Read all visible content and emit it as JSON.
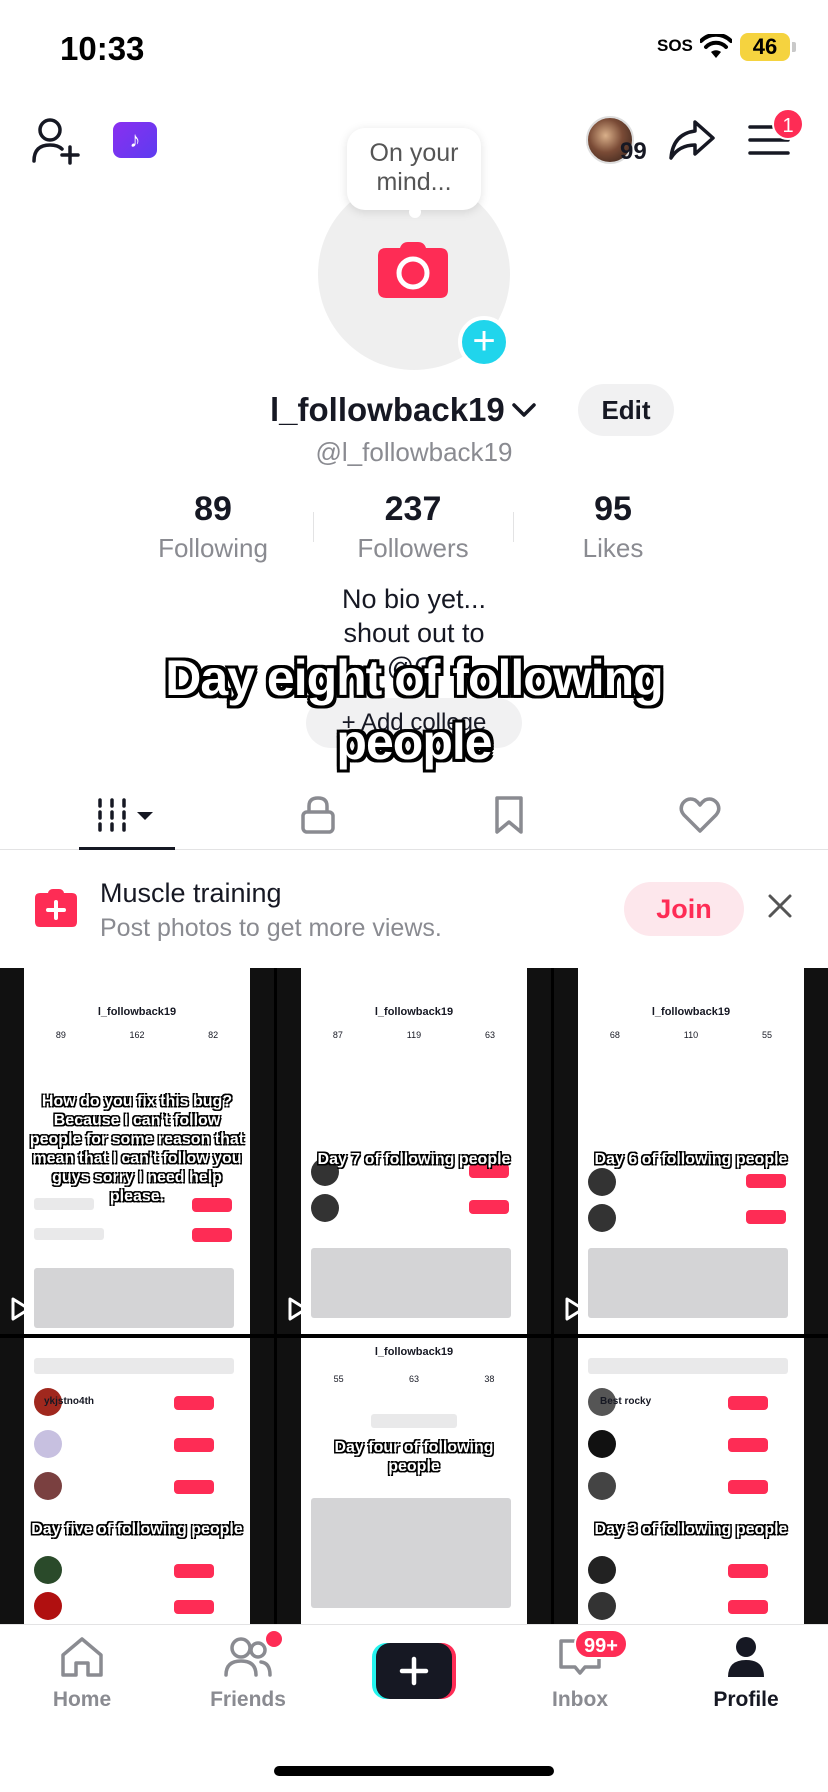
{
  "status_bar": {
    "time": "10:33",
    "sos": "SOS",
    "battery": "46"
  },
  "top_bar": {
    "story_count": "99",
    "menu_badge": "1"
  },
  "profile": {
    "mind_prompt": "On your mind...",
    "username": "l_followback19",
    "edit_label": "Edit",
    "handle": "@l_followback19",
    "stats": [
      {
        "value": "89",
        "label": "Following"
      },
      {
        "value": "237",
        "label": "Followers"
      },
      {
        "value": "95",
        "label": "Likes"
      }
    ],
    "bio_line1": "No bio yet...",
    "bio_line2": "shout out to",
    "bio_line3": "@Œ",
    "add_college": "+ Add college"
  },
  "video_caption": {
    "line1": "Day eight of following",
    "line2": "people"
  },
  "tabs": [
    "videos-tab",
    "private-tab",
    "saved-tab",
    "liked-tab"
  ],
  "banner": {
    "title": "Muscle training",
    "subtitle": "Post photos to get more views.",
    "join_label": "Join"
  },
  "grid": [
    {
      "caption": "How do you fix this bug? Because I can't follow people for some reason that mean that I can't follow you guys sorry I need help please.",
      "user": "l_followback19",
      "stats": [
        "89",
        "162",
        "82"
      ]
    },
    {
      "caption": "Day 7 of following people",
      "user": "l_followback19",
      "stats": [
        "87",
        "119",
        "63"
      ]
    },
    {
      "caption": "Day 6 of following people",
      "user": "l_followback19",
      "stats": [
        "68",
        "110",
        "55"
      ]
    },
    {
      "caption": "Day five of following people",
      "user": "ykjstno4th",
      "stats": []
    },
    {
      "caption": "Day four of following people",
      "user": "l_followback19",
      "stats": [
        "55",
        "63",
        "38"
      ]
    },
    {
      "caption": "Day 3 of following people",
      "user": "Best rocky",
      "stats": []
    }
  ],
  "bottom_nav": {
    "home": "Home",
    "friends": "Friends",
    "inbox": "Inbox",
    "inbox_badge": "99+",
    "profile": "Profile"
  },
  "colors": {
    "accent": "#fe2c55",
    "cyan": "#20d5ec",
    "text": "#161823",
    "muted": "#8a8b91"
  }
}
